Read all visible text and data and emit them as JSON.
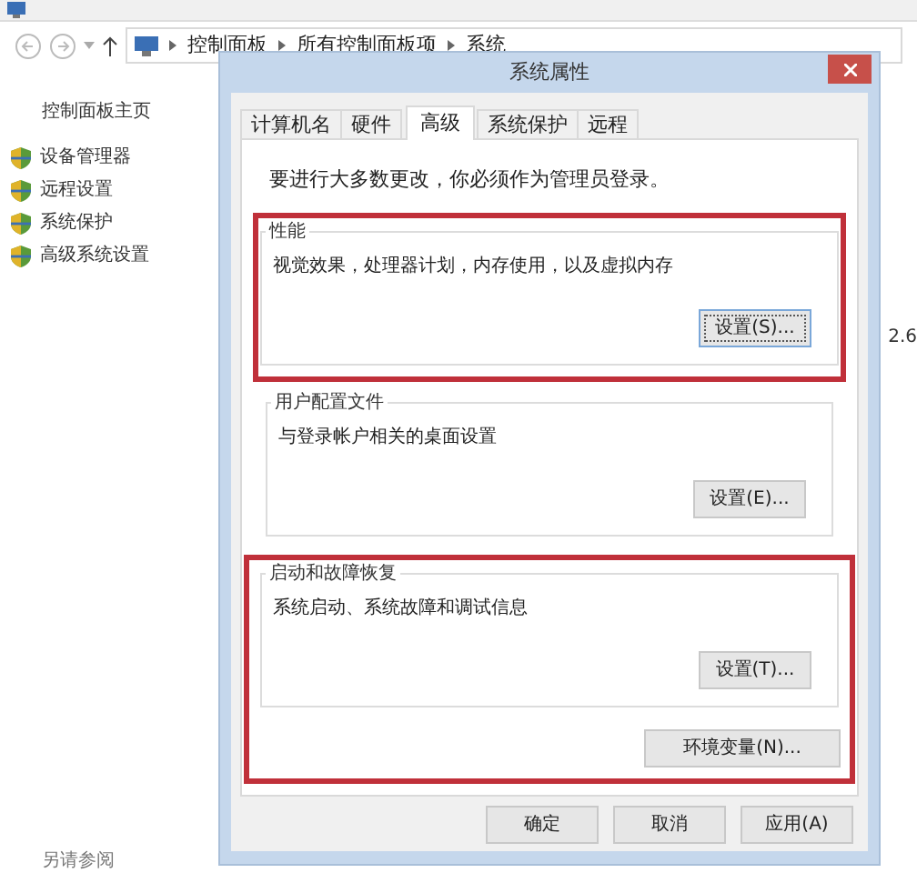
{
  "explorer": {
    "breadcrumbs": [
      "控制面板",
      "所有控制面板项",
      "系统"
    ],
    "sidebar": {
      "home": "控制面板主页",
      "items": [
        {
          "label": "设备管理器"
        },
        {
          "label": "远程设置"
        },
        {
          "label": "系统保护"
        },
        {
          "label": "高级系统设置"
        }
      ],
      "see_also": "另请参阅"
    },
    "column_3": "2.6"
  },
  "dialog": {
    "title": "系统属性",
    "tabs": [
      {
        "label": "计算机名",
        "selected": false
      },
      {
        "label": "硬件",
        "selected": false
      },
      {
        "label": "高级",
        "selected": true
      },
      {
        "label": "系统保护",
        "selected": false
      },
      {
        "label": "远程",
        "selected": false
      }
    ],
    "notice": "要进行大多数更改，你必须作为管理员登录。",
    "blocks": [
      {
        "highlighted": true,
        "groups": [
          {
            "title": "性能",
            "description": "视觉效果，处理器计划，内存使用，以及虚拟内存",
            "button": "设置(S)...",
            "focused": true
          }
        ]
      },
      {
        "highlighted": false,
        "groups": [
          {
            "title": "用户配置文件",
            "description": "与登录帐户相关的桌面设置",
            "button": "设置(E)...",
            "focused": false
          }
        ]
      },
      {
        "highlighted": true,
        "groups": [
          {
            "title": "启动和故障恢复",
            "description": "系统启动、系统故障和调试信息",
            "button": "设置(T)...",
            "focused": false
          }
        ],
        "buttons": [
          "环境变量(N)..."
        ]
      }
    ],
    "footer_buttons": [
      "确定",
      "取消",
      "应用(A)"
    ]
  }
}
